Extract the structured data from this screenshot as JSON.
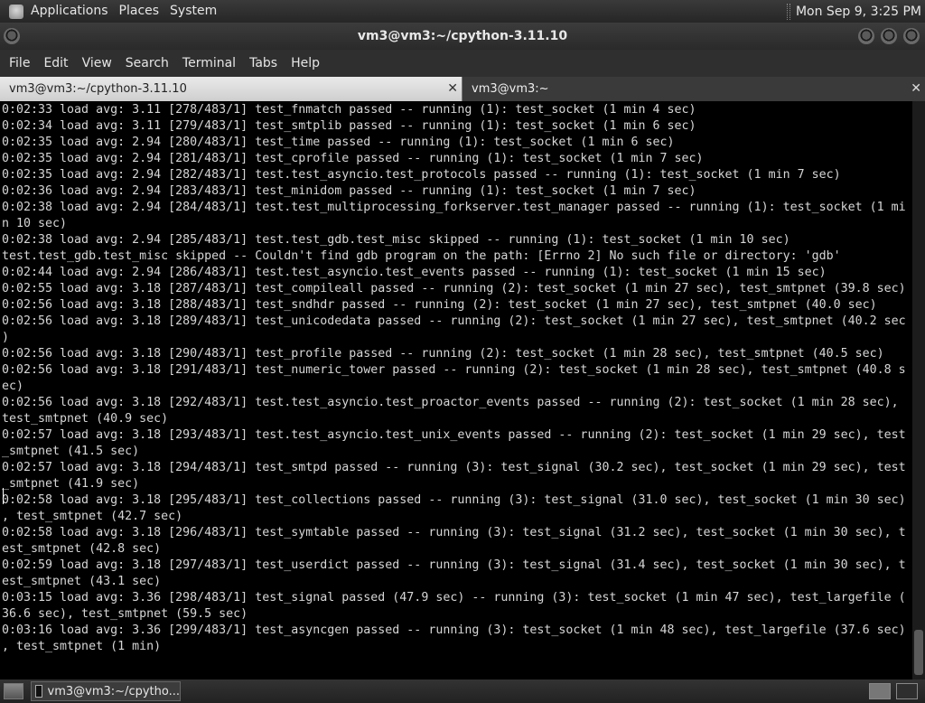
{
  "top_panel": {
    "menus": [
      "Applications",
      "Places",
      "System"
    ],
    "clock": "Mon Sep  9,  3:25 PM"
  },
  "window": {
    "title": "vm3@vm3:~/cpython-3.11.10"
  },
  "menubar": [
    "File",
    "Edit",
    "View",
    "Search",
    "Terminal",
    "Tabs",
    "Help"
  ],
  "tabs": [
    {
      "label": "vm3@vm3:~/cpython-3.11.10",
      "active": true
    },
    {
      "label": "vm3@vm3:~",
      "active": false
    }
  ],
  "terminal": {
    "lines": [
      "0:02:33 load avg: 3.11 [278/483/1] test_fnmatch passed -- running (1): test_socket (1 min 4 sec)",
      "0:02:34 load avg: 3.11 [279/483/1] test_smtplib passed -- running (1): test_socket (1 min 6 sec)",
      "0:02:35 load avg: 2.94 [280/483/1] test_time passed -- running (1): test_socket (1 min 6 sec)",
      "0:02:35 load avg: 2.94 [281/483/1] test_cprofile passed -- running (1): test_socket (1 min 7 sec)",
      "0:02:35 load avg: 2.94 [282/483/1] test.test_asyncio.test_protocols passed -- running (1): test_socket (1 min 7 sec)",
      "0:02:36 load avg: 2.94 [283/483/1] test_minidom passed -- running (1): test_socket (1 min 7 sec)",
      "0:02:38 load avg: 2.94 [284/483/1] test.test_multiprocessing_forkserver.test_manager passed -- running (1): test_socket (1 mi",
      "n 10 sec)",
      "0:02:38 load avg: 2.94 [285/483/1] test.test_gdb.test_misc skipped -- running (1): test_socket (1 min 10 sec)",
      "test.test_gdb.test_misc skipped -- Couldn't find gdb program on the path: [Errno 2] No such file or directory: 'gdb'",
      "0:02:44 load avg: 2.94 [286/483/1] test.test_asyncio.test_events passed -- running (1): test_socket (1 min 15 sec)",
      "0:02:55 load avg: 3.18 [287/483/1] test_compileall passed -- running (2): test_socket (1 min 27 sec), test_smtpnet (39.8 sec)",
      "0:02:56 load avg: 3.18 [288/483/1] test_sndhdr passed -- running (2): test_socket (1 min 27 sec), test_smtpnet (40.0 sec)",
      "0:02:56 load avg: 3.18 [289/483/1] test_unicodedata passed -- running (2): test_socket (1 min 27 sec), test_smtpnet (40.2 sec",
      ")",
      "0:02:56 load avg: 3.18 [290/483/1] test_profile passed -- running (2): test_socket (1 min 28 sec), test_smtpnet (40.5 sec)",
      "0:02:56 load avg: 3.18 [291/483/1] test_numeric_tower passed -- running (2): test_socket (1 min 28 sec), test_smtpnet (40.8 s",
      "ec)",
      "0:02:56 load avg: 3.18 [292/483/1] test.test_asyncio.test_proactor_events passed -- running (2): test_socket (1 min 28 sec),",
      "test_smtpnet (40.9 sec)",
      "0:02:57 load avg: 3.18 [293/483/1] test.test_asyncio.test_unix_events passed -- running (2): test_socket (1 min 29 sec), test",
      "_smtpnet (41.5 sec)",
      "0:02:57 load avg: 3.18 [294/483/1] test_smtpd passed -- running (3): test_signal (30.2 sec), test_socket (1 min 29 sec), test",
      "_smtpnet (41.9 sec)",
      "0:02:58 load avg: 3.18 [295/483/1] test_collections passed -- running (3): test_signal (31.0 sec), test_socket (1 min 30 sec)",
      ", test_smtpnet (42.7 sec)",
      "0:02:58 load avg: 3.18 [296/483/1] test_symtable passed -- running (3): test_signal (31.2 sec), test_socket (1 min 30 sec), t",
      "est_smtpnet (42.8 sec)",
      "0:02:59 load avg: 3.18 [297/483/1] test_userdict passed -- running (3): test_signal (31.4 sec), test_socket (1 min 30 sec), t",
      "est_smtpnet (43.1 sec)",
      "0:03:15 load avg: 3.36 [298/483/1] test_signal passed (47.9 sec) -- running (3): test_socket (1 min 47 sec), test_largefile (",
      "36.6 sec), test_smtpnet (59.5 sec)",
      "0:03:16 load avg: 3.36 [299/483/1] test_asyncgen passed -- running (3): test_socket (1 min 48 sec), test_largefile (37.6 sec)",
      ", test_smtpnet (1 min)"
    ]
  },
  "taskbar": {
    "items": [
      "vm3@vm3:~/cpytho..."
    ]
  }
}
